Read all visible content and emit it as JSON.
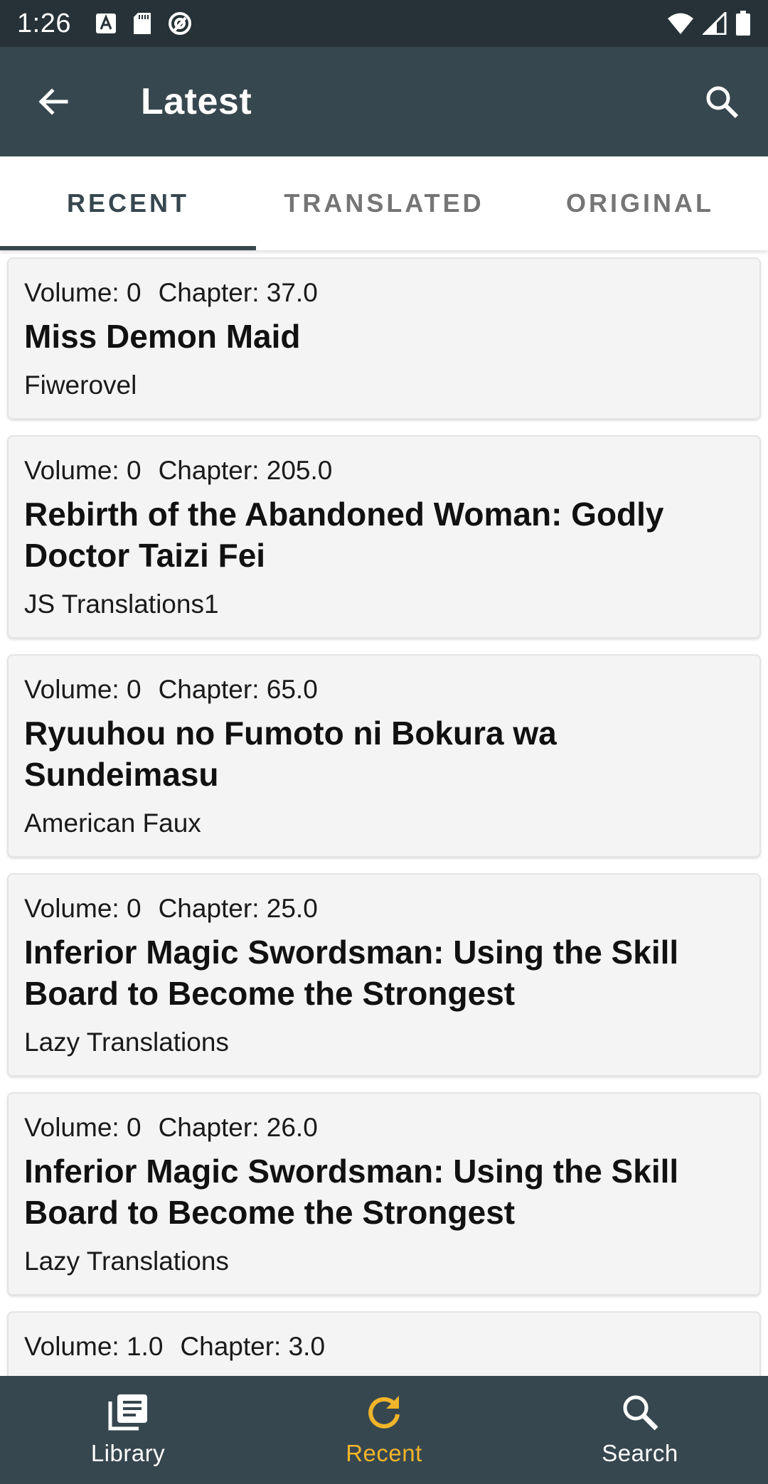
{
  "status_bar": {
    "time": "1:26",
    "icons": [
      "font-notification-icon",
      "sd-card-icon",
      "at-sign-icon",
      "wifi-icon",
      "signal-icon",
      "battery-icon"
    ]
  },
  "app_bar": {
    "title": "Latest",
    "back_icon": "arrow-back-icon",
    "search_icon": "search-icon"
  },
  "tabs": [
    {
      "label": "RECENT",
      "active": true
    },
    {
      "label": "TRANSLATED",
      "active": false
    },
    {
      "label": "ORIGINAL",
      "active": false
    }
  ],
  "releases": [
    {
      "volume": "Volume: 0",
      "chapter": "Chapter: 37.0",
      "title": "Miss Demon Maid",
      "group": "Fiwerovel"
    },
    {
      "volume": "Volume: 0",
      "chapter": "Chapter: 205.0",
      "title": "Rebirth of the Abandoned Woman: Godly Doctor Taizi Fei",
      "group": "JS Translations1"
    },
    {
      "volume": "Volume: 0",
      "chapter": "Chapter: 65.0",
      "title": "Ryuuhou no Fumoto ni Bokura wa Sundeimasu",
      "group": "American Faux"
    },
    {
      "volume": "Volume: 0",
      "chapter": "Chapter: 25.0",
      "title": "Inferior Magic Swordsman: Using the Skill Board to Become the Strongest",
      "group": "Lazy Translations"
    },
    {
      "volume": "Volume: 0",
      "chapter": "Chapter: 26.0",
      "title": "Inferior Magic Swordsman: Using the Skill Board to Become the Strongest",
      "group": "Lazy Translations"
    },
    {
      "volume": "Volume: 1.0",
      "chapter": "Chapter: 3.0",
      "title": "",
      "group": ""
    }
  ],
  "bottom_nav": [
    {
      "label": "Library",
      "icon": "library-icon",
      "active": false
    },
    {
      "label": "Recent",
      "icon": "refresh-icon",
      "active": true
    },
    {
      "label": "Search",
      "icon": "search-icon",
      "active": false
    }
  ],
  "colors": {
    "app_bar": "#37474f",
    "status_bar": "#263238",
    "accent": "#f0b52a",
    "card_bg": "#f4f4f4"
  }
}
